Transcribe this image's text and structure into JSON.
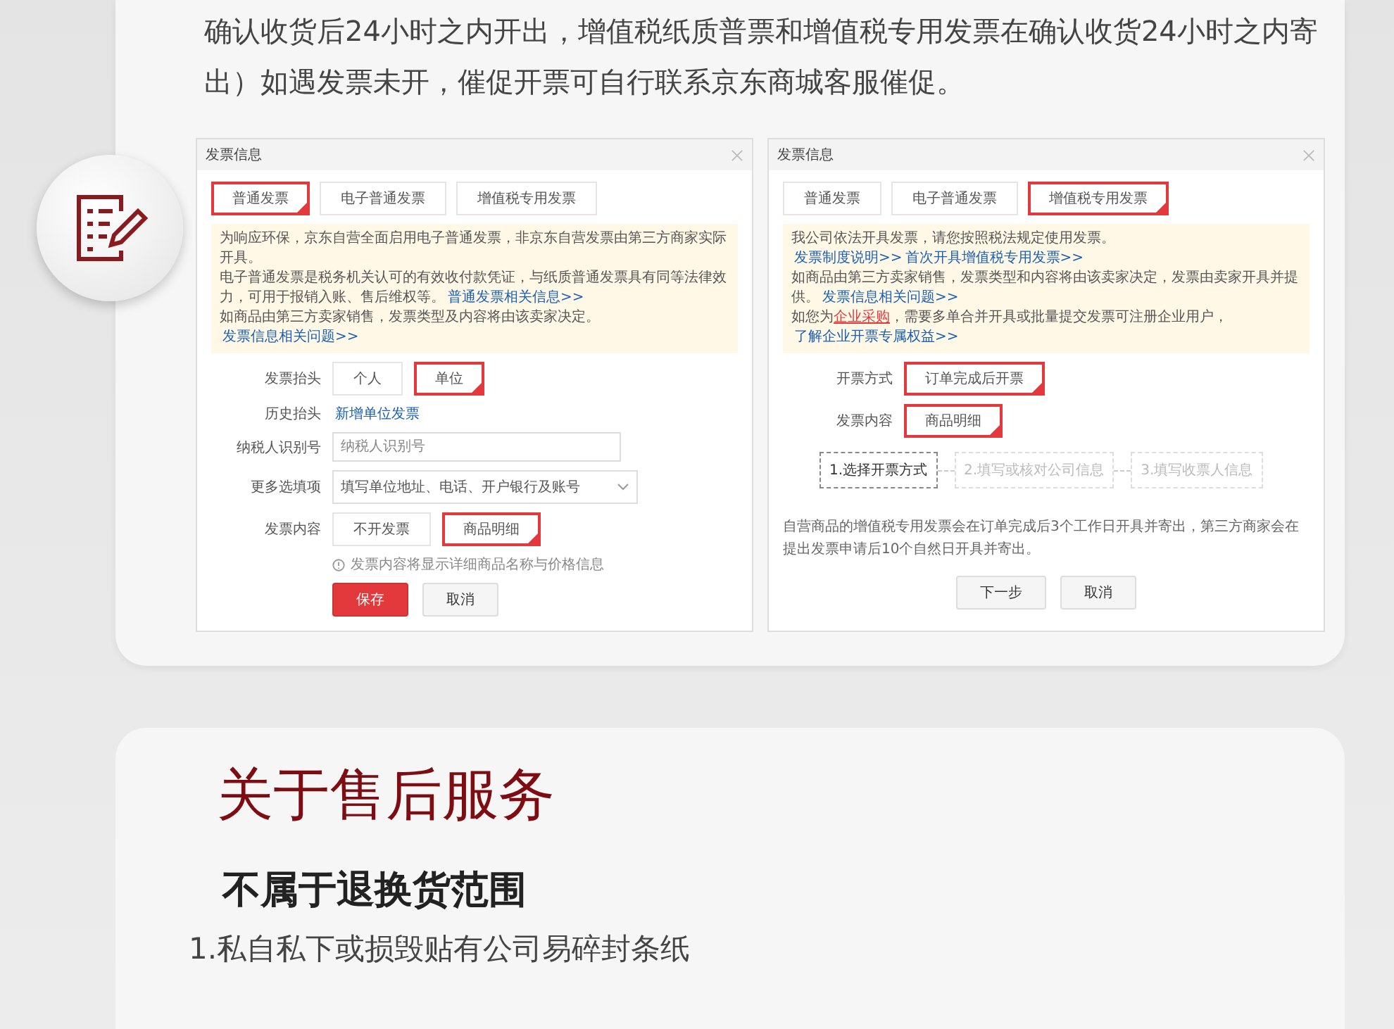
{
  "intro": {
    "text": "确认收货后24小时之内开出，增值税纸质普票和增值税专用发票在确认收货24小时之内寄出）如遇发票未开，催促开票可自行联系京东商城客服催促。"
  },
  "dialogs": [
    {
      "title": "发票信息",
      "tabs": [
        {
          "label": "普通发票",
          "selected": true
        },
        {
          "label": "电子普通发票",
          "selected": false
        },
        {
          "label": "增值税专用发票",
          "selected": false
        }
      ],
      "notice": [
        [
          {
            "kind": "text",
            "text": "为响应环保，京东自营全面启用电子普通发票，非京东自营发票由第三方商家实际开具。"
          }
        ],
        [
          {
            "kind": "text",
            "text": "电子普通发票是税务机关认可的有效收付款凭证，与纸质普通发票具有同等法律效力，可用于报销入账、售后维权等。"
          },
          {
            "kind": "link",
            "text": "普通发票相关信息>>"
          }
        ],
        [
          {
            "kind": "text",
            "text": "如商品由第三方卖家销售，发票类型及内容将由该卖家决定。"
          },
          {
            "kind": "link",
            "text": "发票信息相关问题>>"
          }
        ]
      ],
      "rows": [
        {
          "kind": "options",
          "label": "发票抬头",
          "options": [
            {
              "label": "个人",
              "selected": false
            },
            {
              "label": "单位",
              "selected": true
            }
          ]
        },
        {
          "kind": "link",
          "label": "历史抬头",
          "text": "新增单位发票"
        },
        {
          "kind": "input",
          "label": "纳税人识别号",
          "placeholder": "纳税人识别号"
        },
        {
          "kind": "select",
          "label": "更多选填项",
          "value": "填写单位地址、电话、开户银行及账号"
        },
        {
          "kind": "options",
          "label": "发票内容",
          "options": [
            {
              "label": "不开发票",
              "selected": false
            },
            {
              "label": "商品明细",
              "selected": true
            }
          ]
        },
        {
          "kind": "hint",
          "text": "发票内容将显示详细商品名称与价格信息"
        }
      ],
      "buttons": [
        {
          "label": "保存",
          "primary": true
        },
        {
          "label": "取消",
          "primary": false
        }
      ]
    },
    {
      "title": "发票信息",
      "tabs": [
        {
          "label": "普通发票",
          "selected": false
        },
        {
          "label": "电子普通发票",
          "selected": false
        },
        {
          "label": "增值税专用发票",
          "selected": true
        }
      ],
      "notice": [
        [
          {
            "kind": "text",
            "text": "我公司依法开具发票，请您按照税法规定使用发票。"
          }
        ],
        [
          {
            "kind": "link",
            "text": "发票制度说明>>"
          },
          {
            "kind": "link",
            "text": "首次开具增值税专用发票>>"
          }
        ],
        [
          {
            "kind": "text",
            "text": "如商品由第三方卖家销售，发票类型和内容将由该卖家决定，发票由卖家开具并提供。"
          },
          {
            "kind": "link",
            "text": "发票信息相关问题>>"
          }
        ],
        [
          {
            "kind": "text",
            "text": "如您为"
          },
          {
            "kind": "alert_link",
            "text": "企业采购"
          },
          {
            "kind": "text",
            "text": "，需要多单合并开具或批量提交发票可注册企业用户，"
          },
          {
            "kind": "link",
            "text": "了解企业开票专属权益>>"
          }
        ]
      ],
      "rows": [
        {
          "kind": "options",
          "label": "开票方式",
          "options": [
            {
              "label": "订单完成后开票",
              "selected": true
            }
          ]
        },
        {
          "kind": "options",
          "label": "发票内容",
          "options": [
            {
              "label": "商品明细",
              "selected": true
            }
          ]
        },
        {
          "kind": "steps",
          "steps": [
            {
              "label": "1.选择开票方式",
              "selected": true
            },
            {
              "label": "2.填写或核对公司信息",
              "selected": false
            },
            {
              "label": "3.填写收票人信息",
              "selected": false
            }
          ]
        },
        {
          "kind": "note",
          "text": "自营商品的增值税专用发票会在订单完成后3个工作日开具并寄出，第三方商家会在提出发票申请后10个自然日开具并寄出。"
        }
      ],
      "buttons": [
        {
          "label": "下一步",
          "primary": false
        },
        {
          "label": "取消",
          "primary": false
        }
      ]
    }
  ],
  "after_sales": {
    "title": "关于售后服务",
    "subtitle": "不属于退换货范围",
    "items": [
      "1.私自私下或损毁贴有公司易碎封条纸"
    ]
  }
}
